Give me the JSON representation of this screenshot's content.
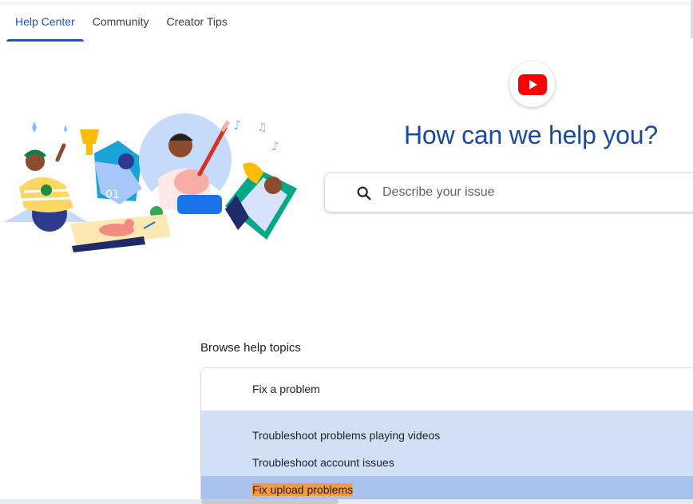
{
  "nav": {
    "tabs": [
      {
        "label": "Help Center",
        "active": true
      },
      {
        "label": "Community",
        "active": false
      },
      {
        "label": "Creator Tips",
        "active": false
      }
    ]
  },
  "hero": {
    "title": "How can we help you?",
    "logo_icon": "youtube-play-icon",
    "brand_color": "#ff0000"
  },
  "search": {
    "placeholder": "Describe your issue",
    "value": "",
    "icon": "search-icon"
  },
  "topics": {
    "section_title": "Browse help topics",
    "card_title": "Fix a problem",
    "items": [
      {
        "label": "Troubleshoot problems playing videos"
      },
      {
        "label": "Troubleshoot account issues"
      },
      {
        "label": "Fix upload problems",
        "selected": true
      }
    ]
  },
  "colors": {
    "accent": "#1a56c4",
    "title": "#1a4aa0",
    "list_bg": "#d2e0f5",
    "selected_row": "#aac2ec",
    "text_highlight": "#f59a3e"
  }
}
